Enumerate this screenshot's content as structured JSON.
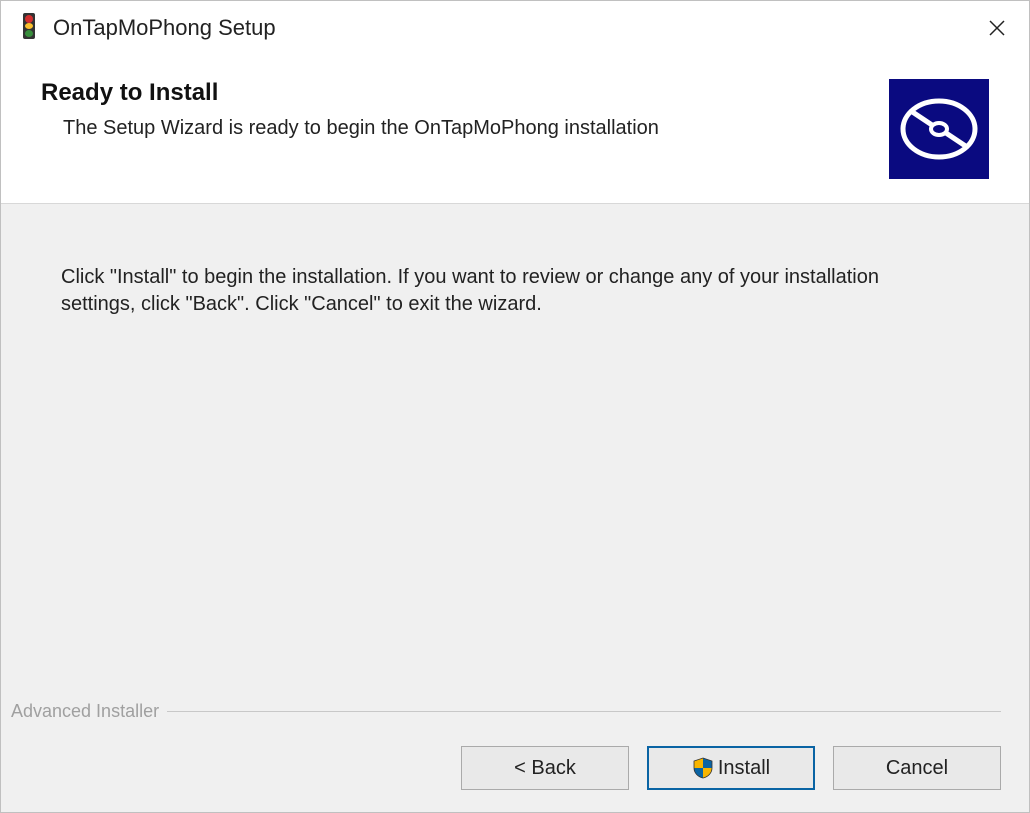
{
  "titlebar": {
    "title": "OnTapMoPhong Setup"
  },
  "header": {
    "title": "Ready to Install",
    "subtitle": "The Setup Wizard is ready to begin the OnTapMoPhong installation"
  },
  "body": {
    "text": "Click \"Install\" to begin the installation.  If you want to review or change any of your installation settings, click \"Back\".  Click \"Cancel\" to exit the wizard."
  },
  "footer": {
    "branding": "Advanced Installer",
    "buttons": {
      "back": "< Back",
      "install": "Install",
      "cancel": "Cancel"
    }
  }
}
